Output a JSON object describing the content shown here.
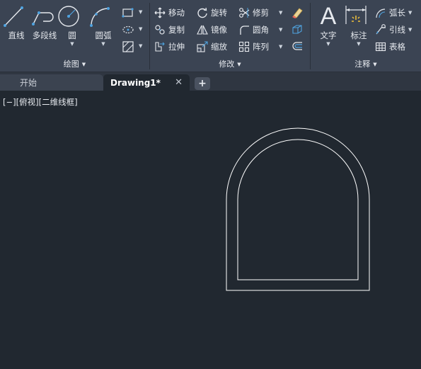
{
  "ribbon": {
    "draw_panel": {
      "title": "绘图",
      "line_label": "直线",
      "polyline_label": "多段线",
      "circle_label": "圆",
      "arc_label": "圆弧"
    },
    "modify_panel": {
      "title": "修改",
      "move_label": "移动",
      "rotate_label": "旋转",
      "trim_label": "修剪",
      "copy_label": "复制",
      "mirror_label": "镜像",
      "fillet_label": "圆角",
      "stretch_label": "拉伸",
      "scale_label": "缩放",
      "array_label": "阵列"
    },
    "annotation_panel": {
      "title": "注释",
      "text_label": "文字",
      "dimension_label": "标注",
      "arc_length_label": "弧长",
      "leader_label": "引线",
      "table_label": "表格"
    }
  },
  "tabs": {
    "start_label": "开始",
    "drawing_label": "Drawing1*",
    "close_symbol": "✕",
    "add_symbol": "+"
  },
  "viewport": {
    "control_minus": "[−]",
    "view_name": "[俯视]",
    "visual_style": "[二维线框]"
  },
  "colors": {
    "ribbon_bg": "#3b4453",
    "canvas_bg": "#212830",
    "icon_blue": "#4fa3e0",
    "drawing_line": "#ffffff"
  }
}
